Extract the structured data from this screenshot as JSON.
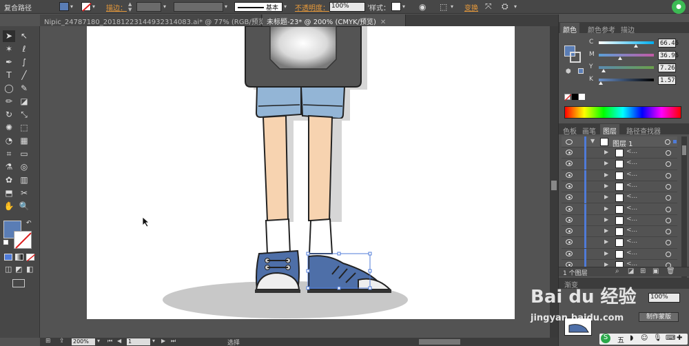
{
  "control_bar": {
    "object_type": "复合路径",
    "stroke_label": "描边：",
    "stroke_style": "基本",
    "opacity_label": "不透明度：",
    "opacity_value": "100%",
    "style_label": "样式：",
    "transform_label": "变换",
    "fill_color": "#5a7db5"
  },
  "doc_tabs": [
    {
      "label": "Nipic_24787180_20181223144932314083.ai* @ 77% (RGB/预览)",
      "close": "✕"
    },
    {
      "label": "未标题-23* @ 200% (CMYK/预览)",
      "close": "✕"
    }
  ],
  "toolbar": {
    "tools": [
      "selection-tool",
      "direct-selection-tool",
      "magic-wand-tool",
      "lasso-tool",
      "pen-tool",
      "curvature-tool",
      "type-tool",
      "line-tool",
      "ellipse-tool",
      "paintbrush-tool",
      "pencil-tool",
      "eraser-tool",
      "rotate-tool",
      "scale-tool",
      "puppet-warp-tool",
      "free-transform-tool",
      "shape-builder-tool",
      "perspective-grid-tool",
      "mesh-tool",
      "gradient-tool",
      "eyedropper-tool",
      "blend-tool",
      "symbol-sprayer-tool",
      "column-graph-tool",
      "artboard-tool",
      "slice-tool",
      "hand-tool",
      "zoom-tool"
    ],
    "tool_glyphs": [
      "➤",
      "↖",
      "✶",
      "ℓ",
      "✒",
      "∫",
      "T",
      "╱",
      "◯",
      "✎",
      "✏",
      "◪",
      "↻",
      "⤡",
      "✺",
      "⬚",
      "◔",
      "▦",
      "⌗",
      "▭",
      "⚗",
      "◎",
      "✿",
      "▥",
      "⬒",
      "✂",
      "✋",
      "🔍"
    ],
    "fill_swatch": "#5a7db5"
  },
  "status_bar": {
    "zoom": "200%",
    "page": "1",
    "tool": "选择"
  },
  "color_panel": {
    "tabs": [
      "颜色",
      "颜色参考",
      "描边"
    ],
    "channels": [
      {
        "name": "C",
        "value": "66.46",
        "pos": 0.66,
        "gradient": "linear-gradient(90deg,#fff,#00aeef)"
      },
      {
        "name": "M",
        "value": "36.96",
        "pos": 0.37,
        "gradient": "linear-gradient(90deg,#5aa0d8,#c25aa5)"
      },
      {
        "name": "Y",
        "value": "7.26",
        "pos": 0.07,
        "gradient": "linear-gradient(90deg,#5a8ab0,#6aa04a)"
      },
      {
        "name": "K",
        "value": "1.57",
        "pos": 0.02,
        "gradient": "linear-gradient(90deg,#6a90c8,#000)"
      }
    ],
    "fill": "#5a7db5"
  },
  "layers_panel": {
    "tabs": [
      "色板",
      "画笔",
      "图层",
      "路径查找器"
    ],
    "top_layer": "图层 1",
    "sublayer_label": "<...",
    "sublayer_count": 11,
    "footer": "1 个图层"
  },
  "bottom_panel": {
    "tab": "渐变",
    "opacity_value": "100%",
    "make_mask_button": "制作蒙版"
  },
  "watermark": {
    "brand": "Bai du 经验",
    "url": "jingyan.baidu.com"
  }
}
